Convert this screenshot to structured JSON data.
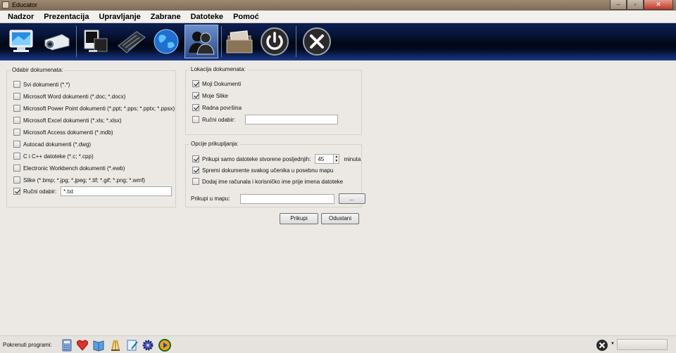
{
  "window": {
    "title": "Educator",
    "minimize": "–",
    "maximize": "▫",
    "close": "✕"
  },
  "menu": [
    "Nadzor",
    "Prezentacija",
    "Upravljanje",
    "Zabrane",
    "Datoteke",
    "Pomoć"
  ],
  "toolbar": {
    "icons": [
      "monitor-icon",
      "projector-icon",
      "screen-icon",
      "keyboard-icon",
      "globe-icon",
      "users-icon",
      "files-icon",
      "power-icon",
      "close-icon"
    ],
    "selected": "users-icon"
  },
  "documents_group": {
    "legend": "Odabir dokumenata:",
    "items": [
      {
        "label": "Svi dokumenti (*.*)",
        "checked": false
      },
      {
        "label": "Microsoft Word dokumenti (*.doc; *.docx)",
        "checked": false
      },
      {
        "label": "Microsoft Power Point dokumenti (*.ppt; *.pps; *.pptx; *.ppsx)",
        "checked": false
      },
      {
        "label": "Microsoft Excel dokumenti (*.xls; *.xlsx)",
        "checked": false
      },
      {
        "label": "Microsoft Access dokumenti (*.mdb)",
        "checked": false
      },
      {
        "label": "Autocad dokumenti (*.dwg)",
        "checked": false
      },
      {
        "label": "C i C++ datoteke (*.c; *.cpp)",
        "checked": false
      },
      {
        "label": "Electronic Workbench dokumenti (*.ewb)",
        "checked": false
      },
      {
        "label": "Slike (*.bmp; *.jpg; *.jpeg; *.tif; *.gif; *.png; *.wmf)",
        "checked": false
      }
    ],
    "manual": {
      "label": "Ručni odabir:",
      "checked": true,
      "value": "*.txt"
    }
  },
  "location_group": {
    "legend": "Lokacija dokumenata:",
    "items": [
      {
        "label": "Moji Dokumenti",
        "checked": true
      },
      {
        "label": "Moje Slike",
        "checked": true
      },
      {
        "label": "Radna površina",
        "checked": true
      }
    ],
    "manual": {
      "label": "Ručni odabir:",
      "checked": false,
      "value": ""
    }
  },
  "options_group": {
    "legend": "Opcije prikupljanja:",
    "collect_recent": {
      "label": "Prikupi samo datoteke stvorene posljednjih:",
      "checked": true,
      "minutes": "45",
      "unit": "minuta"
    },
    "save_per_student": {
      "label": "Spremi dokumente svakog učenika u posebnu mapu",
      "checked": true
    },
    "prefix_names": {
      "label": "Dodaj ime računala i korisničko ime prije imena datoteke",
      "checked": false
    },
    "folder": {
      "label": "Prikupi u mapu:",
      "value": "",
      "browse": "..."
    }
  },
  "buttons": {
    "collect": "Prikupi",
    "cancel": "Odustani"
  },
  "status": {
    "label": "Pokrenuti programi:",
    "programs": [
      "calculator-icon",
      "heart-icon",
      "book-icon",
      "paint-icon",
      "notepad-icon",
      "gear-icon",
      "media-player-icon"
    ]
  },
  "colors": {
    "toolbar": "#08143a",
    "selected_tool": "#4a6fb0",
    "background": "#ece9e4"
  }
}
